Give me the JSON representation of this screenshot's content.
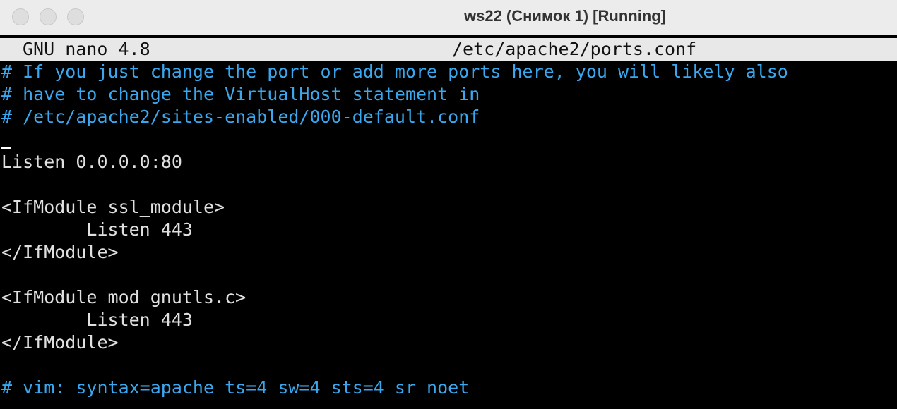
{
  "window": {
    "title": "ws22 (Снимок 1) [Running]"
  },
  "editor": {
    "app_version": "GNU nano 4.8",
    "file_path": "/etc/apache2/ports.conf"
  },
  "lines": [
    {
      "text": "# If you just change the port or add more ports here, you will likely also",
      "kind": "comment"
    },
    {
      "text": "# have to change the VirtualHost statement in",
      "kind": "comment"
    },
    {
      "text": "# /etc/apache2/sites-enabled/000-default.conf",
      "kind": "comment"
    },
    {
      "text": "",
      "kind": "normal"
    },
    {
      "text": "Listen 0.0.0.0:80",
      "kind": "normal"
    },
    {
      "text": "",
      "kind": "normal"
    },
    {
      "text": "<IfModule ssl_module>",
      "kind": "normal"
    },
    {
      "text": "        Listen 443",
      "kind": "normal"
    },
    {
      "text": "</IfModule>",
      "kind": "normal"
    },
    {
      "text": "",
      "kind": "normal"
    },
    {
      "text": "<IfModule mod_gnutls.c>",
      "kind": "normal"
    },
    {
      "text": "        Listen 443",
      "kind": "normal"
    },
    {
      "text": "</IfModule>",
      "kind": "normal"
    },
    {
      "text": "",
      "kind": "normal"
    },
    {
      "text": "# vim: syntax=apache ts=4 sw=4 sts=4 sr noet",
      "kind": "comment"
    }
  ],
  "colors": {
    "comment": "#3aa7ee",
    "text": "#e0e0e0",
    "background": "#000000",
    "header_bg": "#e8e8e8"
  }
}
